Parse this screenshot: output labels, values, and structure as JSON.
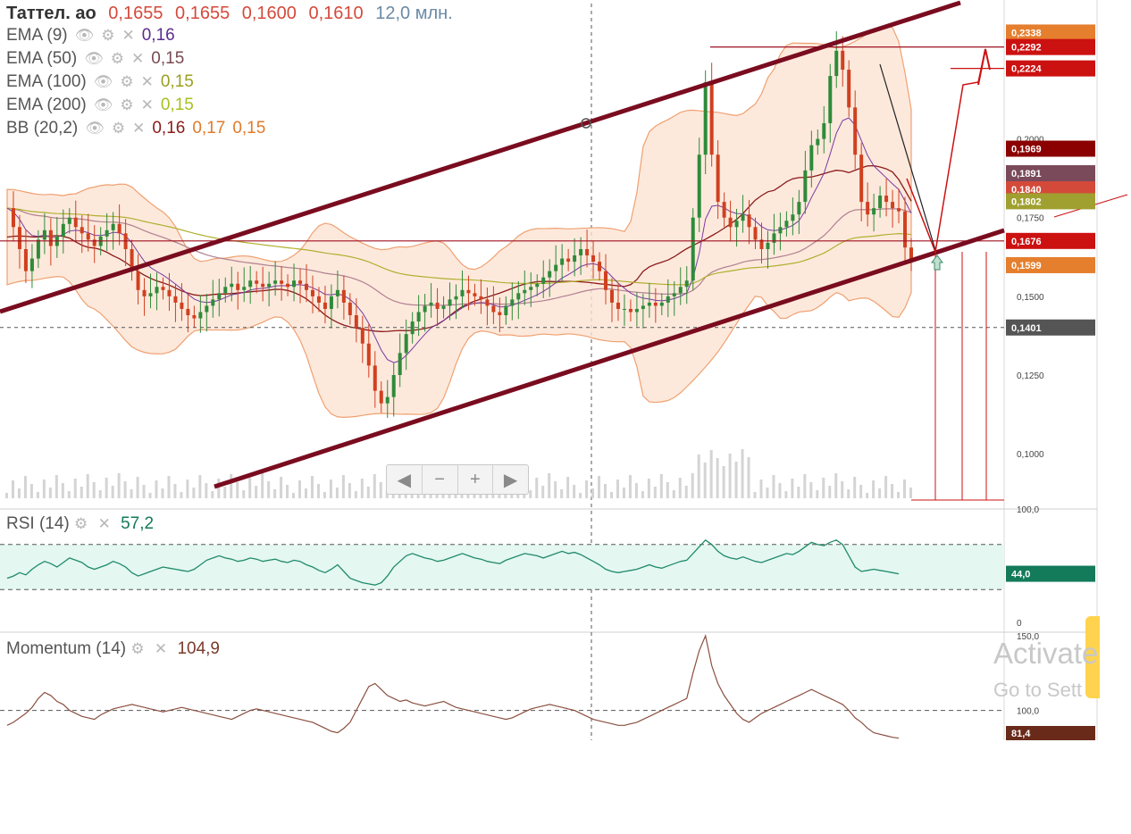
{
  "header": {
    "ticker": "Таттел. ао",
    "open": "0,1655",
    "high": "0,1655",
    "low": "0,1600",
    "close": "0,1610",
    "volume": "12,0 млн."
  },
  "indicators": [
    {
      "label": "EMA (9)",
      "values": [
        "0,16"
      ],
      "colors": [
        "#5b2d8e"
      ]
    },
    {
      "label": "EMA (50)",
      "values": [
        "0,15"
      ],
      "colors": [
        "#7a4a52"
      ]
    },
    {
      "label": "EMA (100)",
      "values": [
        "0,15"
      ],
      "colors": [
        "#9aa020"
      ]
    },
    {
      "label": "EMA (200)",
      "values": [
        "0,15"
      ],
      "colors": [
        "#a8c020"
      ]
    },
    {
      "label": "BB (20,2)",
      "values": [
        "0,16",
        "0,17",
        "0,15"
      ],
      "colors": [
        "#8b1a1a",
        "#e07a2a",
        "#e07a2a"
      ]
    }
  ],
  "icons": {
    "eye": "eye-icon",
    "gear": "gear-icon",
    "close": "close-icon"
  },
  "price_axis": {
    "ticks": [
      "0,2000",
      "0,1750",
      "0,1500",
      "0,1250",
      "0,1000"
    ],
    "tick_values": [
      0.2,
      0.175,
      0.15,
      0.125,
      0.1
    ],
    "badges": [
      {
        "text": "0,2338",
        "value": 0.2338,
        "color": "#e57f2e"
      },
      {
        "text": "0,2292",
        "value": 0.2292,
        "color": "#cc1111"
      },
      {
        "text": "0,2224",
        "value": 0.2224,
        "color": "#cc1111"
      },
      {
        "text": "0,1969",
        "value": 0.1969,
        "color": "#8b0000"
      },
      {
        "text": "0,1891",
        "value": 0.1891,
        "color": "#7a4a5a"
      },
      {
        "text": "0,1840",
        "value": 0.184,
        "color": "#d44a3a"
      },
      {
        "text": "0,1802",
        "value": 0.1802,
        "color": "#a0a030"
      },
      {
        "text": "0,1676",
        "value": 0.1676,
        "color": "#cc1111"
      },
      {
        "text": "0,1599",
        "value": 0.1599,
        "color": "#e57f2e"
      },
      {
        "text": "0,1401",
        "value": 0.1401,
        "color": "#555555"
      }
    ],
    "range": [
      0.085,
      0.243
    ]
  },
  "rsi": {
    "label": "RSI (14)",
    "value": "57,2",
    "axis_top": "100,0",
    "axis_bottom": "0",
    "badge": "44,0",
    "levels": [
      70,
      30
    ]
  },
  "momentum": {
    "label": "Momentum (14)",
    "value": "104,9",
    "axis_top": "150,0",
    "axis_mid": "100,0",
    "badge": "81,4"
  },
  "nav": {
    "left": "◀",
    "minus": "−",
    "plus": "+",
    "right": "▶"
  },
  "watermark": {
    "line1": "Activate",
    "line2": "Go to Sett"
  },
  "colors": {
    "up": "#2e8b3a",
    "down": "#d04020",
    "bb_fill": "#fde3d3",
    "bb_line": "#f0a070",
    "channel": "#7a0c1f",
    "red": "#cc1111"
  },
  "chart_data": {
    "type": "candlestick",
    "title": "Таттел. ао",
    "closes": [
      0.178,
      0.172,
      0.165,
      0.158,
      0.162,
      0.168,
      0.171,
      0.166,
      0.169,
      0.173,
      0.175,
      0.172,
      0.17,
      0.168,
      0.166,
      0.169,
      0.171,
      0.173,
      0.17,
      0.165,
      0.158,
      0.152,
      0.15,
      0.151,
      0.153,
      0.152,
      0.15,
      0.148,
      0.146,
      0.144,
      0.143,
      0.145,
      0.147,
      0.149,
      0.151,
      0.153,
      0.154,
      0.152,
      0.153,
      0.155,
      0.154,
      0.153,
      0.154,
      0.155,
      0.154,
      0.153,
      0.155,
      0.154,
      0.152,
      0.15,
      0.148,
      0.146,
      0.15,
      0.152,
      0.148,
      0.144,
      0.14,
      0.135,
      0.128,
      0.12,
      0.116,
      0.118,
      0.125,
      0.132,
      0.138,
      0.142,
      0.145,
      0.147,
      0.148,
      0.146,
      0.147,
      0.149,
      0.15,
      0.152,
      0.151,
      0.15,
      0.149,
      0.147,
      0.145,
      0.144,
      0.147,
      0.149,
      0.151,
      0.152,
      0.153,
      0.154,
      0.156,
      0.158,
      0.16,
      0.162,
      0.161,
      0.163,
      0.165,
      0.163,
      0.161,
      0.158,
      0.152,
      0.148,
      0.146,
      0.146,
      0.145,
      0.146,
      0.147,
      0.148,
      0.147,
      0.148,
      0.15,
      0.151,
      0.153,
      0.155,
      0.175,
      0.195,
      0.218,
      0.195,
      0.18,
      0.175,
      0.172,
      0.174,
      0.176,
      0.172,
      0.168,
      0.165,
      0.167,
      0.17,
      0.172,
      0.174,
      0.176,
      0.18,
      0.19,
      0.198,
      0.2,
      0.205,
      0.22,
      0.228,
      0.222,
      0.21,
      0.195,
      0.18,
      0.176,
      0.178,
      0.182,
      0.18,
      0.178,
      0.177,
      0.1655,
      0.161
    ],
    "rsi": [
      40,
      42,
      45,
      43,
      48,
      52,
      55,
      53,
      50,
      54,
      58,
      56,
      54,
      50,
      48,
      50,
      52,
      55,
      53,
      50,
      45,
      42,
      44,
      46,
      48,
      50,
      49,
      48,
      47,
      46,
      48,
      52,
      56,
      58,
      60,
      58,
      57,
      55,
      56,
      58,
      57,
      55,
      56,
      57,
      55,
      54,
      56,
      55,
      52,
      50,
      47,
      45,
      48,
      52,
      46,
      40,
      38,
      36,
      35,
      34,
      36,
      42,
      50,
      55,
      60,
      62,
      60,
      58,
      57,
      55,
      56,
      58,
      60,
      62,
      60,
      58,
      57,
      55,
      54,
      53,
      56,
      58,
      60,
      62,
      61,
      60,
      58,
      60,
      62,
      64,
      62,
      63,
      61,
      58,
      55,
      52,
      48,
      46,
      45,
      46,
      47,
      48,
      50,
      52,
      50,
      49,
      51,
      53,
      55,
      56,
      62,
      68,
      74,
      70,
      64,
      60,
      58,
      57,
      59,
      57,
      55,
      54,
      56,
      58,
      60,
      62,
      61,
      64,
      68,
      72,
      70,
      69,
      72,
      74,
      70,
      60,
      50,
      46,
      47,
      48,
      47,
      46,
      45,
      44
    ],
    "momentum": [
      90,
      92,
      95,
      98,
      102,
      108,
      112,
      110,
      106,
      104,
      100,
      98,
      96,
      95,
      94,
      97,
      99,
      101,
      102,
      103,
      104,
      103,
      102,
      101,
      100,
      99,
      100,
      101,
      102,
      101,
      100,
      99,
      98,
      97,
      96,
      95,
      94,
      96,
      98,
      100,
      101,
      100,
      99,
      98,
      97,
      96,
      95,
      94,
      93,
      92,
      90,
      88,
      86,
      85,
      88,
      92,
      100,
      108,
      116,
      118,
      114,
      110,
      108,
      106,
      107,
      105,
      104,
      103,
      104,
      105,
      106,
      104,
      102,
      101,
      100,
      99,
      98,
      97,
      96,
      95,
      94,
      95,
      97,
      99,
      101,
      102,
      103,
      104,
      103,
      102,
      101,
      100,
      98,
      96,
      94,
      93,
      92,
      91,
      90,
      90,
      91,
      92,
      94,
      96,
      98,
      100,
      102,
      104,
      106,
      108,
      125,
      140,
      150,
      130,
      118,
      110,
      104,
      98,
      94,
      92,
      95,
      98,
      100,
      102,
      104,
      106,
      108,
      110,
      112,
      114,
      112,
      110,
      108,
      106,
      104,
      100,
      95,
      92,
      88,
      85,
      84,
      83,
      82,
      81.4
    ],
    "ylim": [
      0.085,
      0.243
    ]
  }
}
